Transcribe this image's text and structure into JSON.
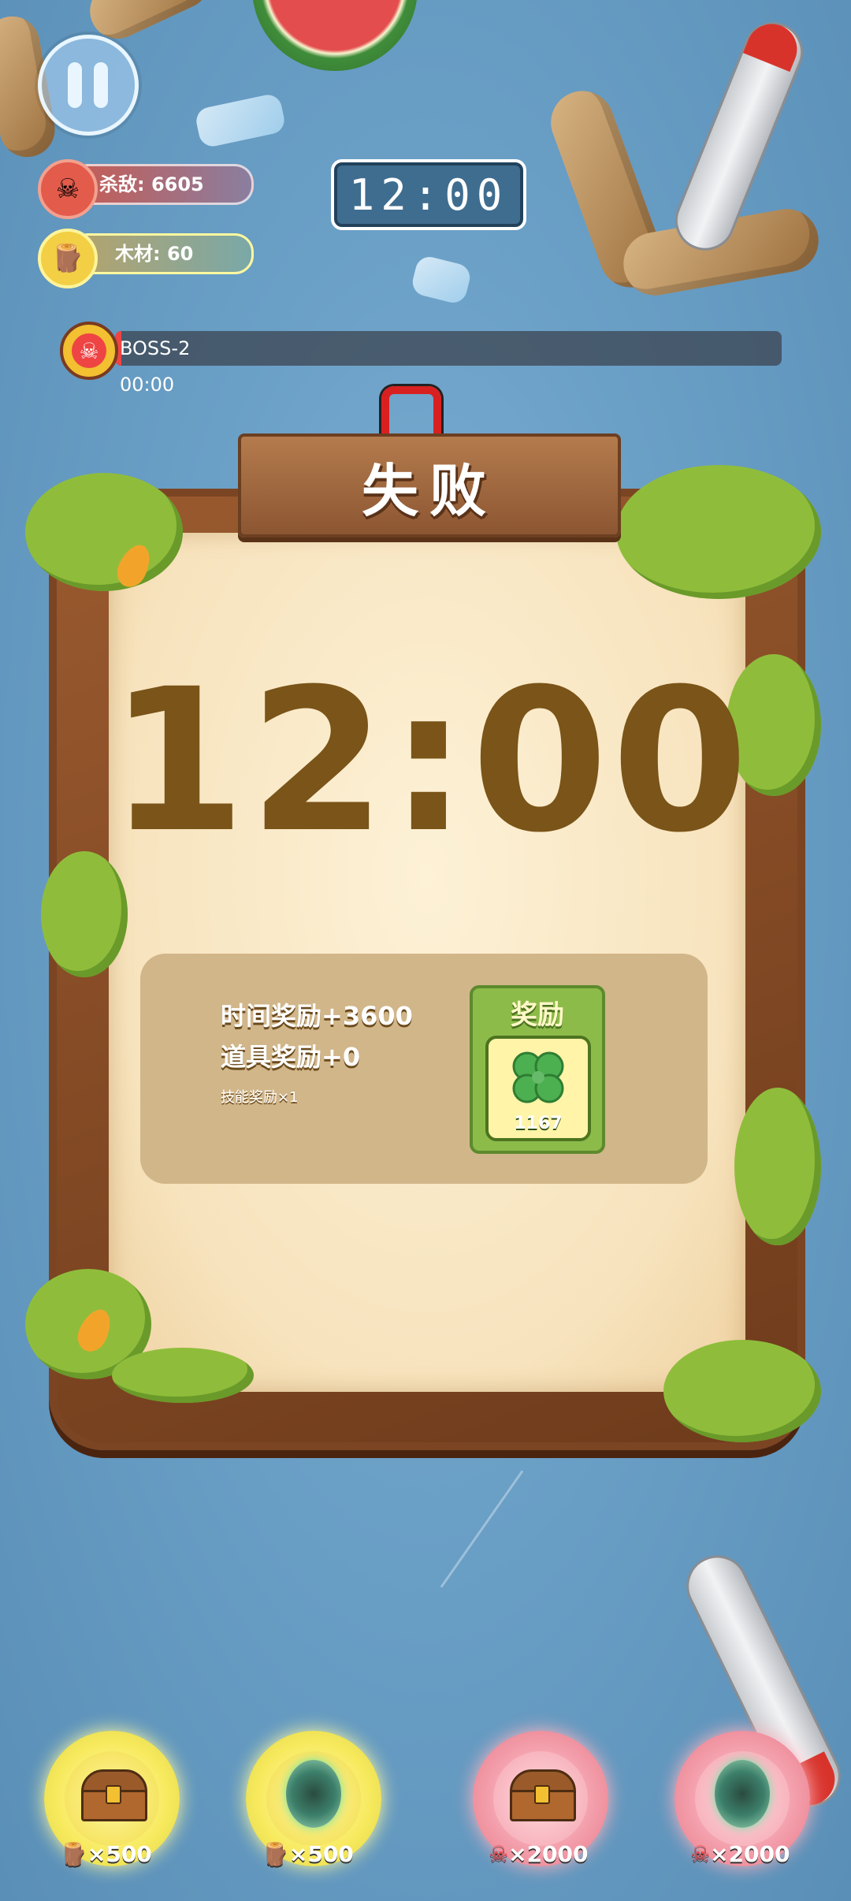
{
  "hud": {
    "kills_text": "杀敌: 6605",
    "wood_text": "木材: 60",
    "timer": "12:00"
  },
  "boss": {
    "name": "BOSS-2",
    "time": "00:00",
    "progress": 0.01
  },
  "result": {
    "title": "失败",
    "time": "12:00",
    "reward_lines": {
      "time_reward": "时间奖励+3600",
      "item_reward": "道具奖励+0",
      "skill_reward": "技能奖励×1"
    },
    "reward_card": {
      "header": "奖励",
      "icon": "four-leaf-clover-icon",
      "count": "1167"
    }
  },
  "bottom_buttons": [
    {
      "type": "treasure-chest",
      "cost": "×500",
      "currency": "wood",
      "color": "#f7e95c"
    },
    {
      "type": "portal",
      "cost": "×500",
      "currency": "wood",
      "color": "#f7e95c"
    },
    {
      "type": "treasure-chest",
      "cost": "×2000",
      "currency": "kills",
      "color": "#f29aa7"
    },
    {
      "type": "portal",
      "cost": "×2000",
      "currency": "kills",
      "color": "#f29aa7"
    }
  ],
  "colors": {
    "brown_text": "#7a5418",
    "danger": "#e44",
    "panel_wood": "#8c5632"
  }
}
